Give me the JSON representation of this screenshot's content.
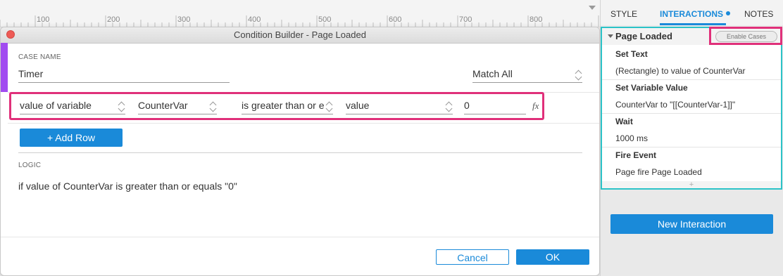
{
  "ruler": {
    "labels": [
      "100",
      "200",
      "300",
      "400",
      "500",
      "600",
      "700",
      "800"
    ]
  },
  "dialog": {
    "title": "Condition Builder   -   Page Loaded",
    "case_name_label": "CASE NAME",
    "case_name_value": "Timer",
    "match_value": "Match All",
    "condition": {
      "source": "value of variable",
      "variable": "CounterVar",
      "operator": "is greater than or e",
      "target_type": "value",
      "target_value": "0",
      "fx_glyph": "fx"
    },
    "add_row_label": "+ Add Row",
    "logic_label": "LOGIC",
    "logic_text": "if value of CounterVar is greater than or equals \"0\"",
    "cancel_label": "Cancel",
    "ok_label": "OK"
  },
  "right_panel": {
    "tabs": [
      "STYLE",
      "INTERACTIONS",
      "NOTES"
    ],
    "active_tab": "INTERACTIONS",
    "event_title": "Page Loaded",
    "enable_cases_label": "Enable Cases",
    "actions": [
      {
        "title": "Set Text",
        "detail": "(Rectangle) to value of CounterVar"
      },
      {
        "title": "Set Variable Value",
        "detail": "CounterVar to \"[[CounterVar-1]]\""
      },
      {
        "title": "Wait",
        "detail": "1000 ms"
      },
      {
        "title": "Fire Event",
        "detail": "Page fire Page Loaded"
      }
    ],
    "plus_glyph": "+",
    "new_interaction_label": "New Interaction"
  },
  "colors": {
    "accent_blue": "#1a8ad9",
    "highlight_pink": "#e0307a",
    "highlight_teal": "#2bc3c8",
    "case_purple": "#a14cf0",
    "close_red": "#ee5b56"
  }
}
